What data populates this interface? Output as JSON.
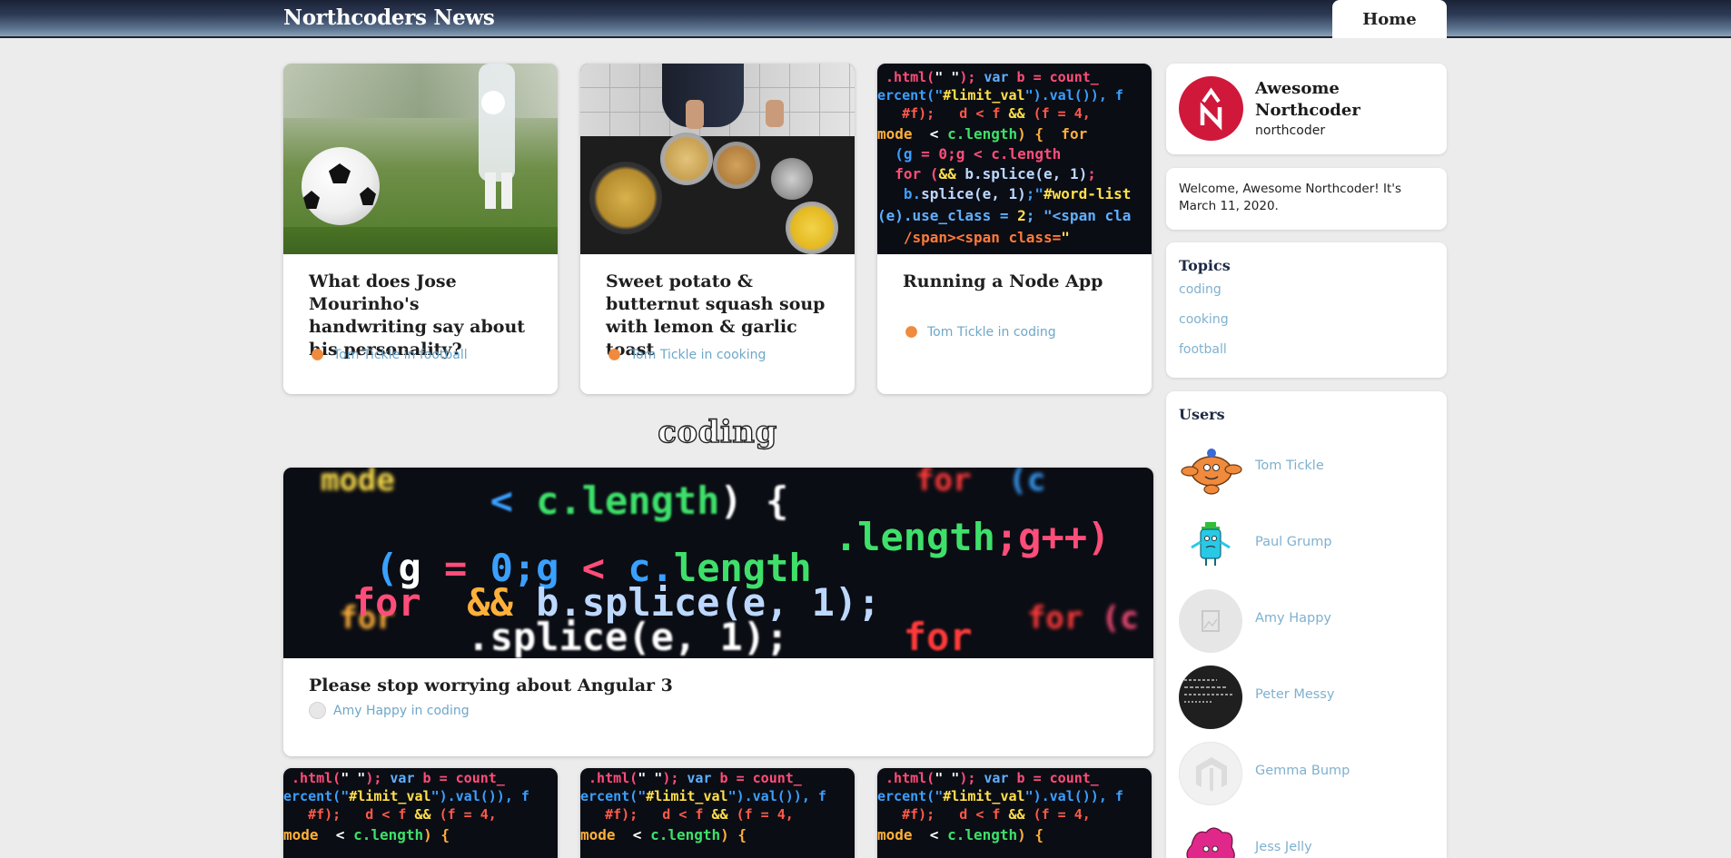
{
  "header": {
    "brand": "Northcoders News",
    "home_tab": "Home"
  },
  "featured_articles": [
    {
      "title": "What does Jose Mourinho's handwriting say about his personality?",
      "author": "Tom Tickle",
      "topic": "football",
      "image": "football-photo"
    },
    {
      "title": "Sweet potato & butternut squash soup with lemon & garlic toast",
      "author": "Tom Tickle",
      "topic": "cooking",
      "image": "cooking-photo"
    },
    {
      "title": "Running a Node App",
      "author": "Tom Tickle",
      "topic": "coding",
      "image": "code-photo"
    }
  ],
  "section": {
    "heading": "coding"
  },
  "section_article": {
    "title": "Please stop worrying about Angular 3",
    "author": "Amy Happy",
    "topic": "coding",
    "image": "code-photo-wide"
  },
  "meta_joiner": "in",
  "profile": {
    "name": "Awesome Northcoder",
    "username": "northcoder",
    "avatar_color": "#d0183b"
  },
  "welcome": {
    "text": "Welcome, Awesome Northcoder! It's March 11, 2020."
  },
  "topics": {
    "heading": "Topics",
    "items": [
      "coding",
      "cooking",
      "football"
    ]
  },
  "users": {
    "heading": "Users",
    "items": [
      {
        "name": "Tom Tickle",
        "avatar": "orange-character"
      },
      {
        "name": "Paul Grump",
        "avatar": "blue-character"
      },
      {
        "name": "Amy Happy",
        "avatar": "placeholder-image"
      },
      {
        "name": "Peter Messy",
        "avatar": "dark-text-image"
      },
      {
        "name": "Gemma Bump",
        "avatar": "grey-logo"
      },
      {
        "name": "Jess Jelly",
        "avatar": "pink-character"
      }
    ]
  },
  "colors": {
    "link": "#7fb1cf",
    "meta": "#6ea7c9",
    "header_dark": "#1a2236"
  }
}
